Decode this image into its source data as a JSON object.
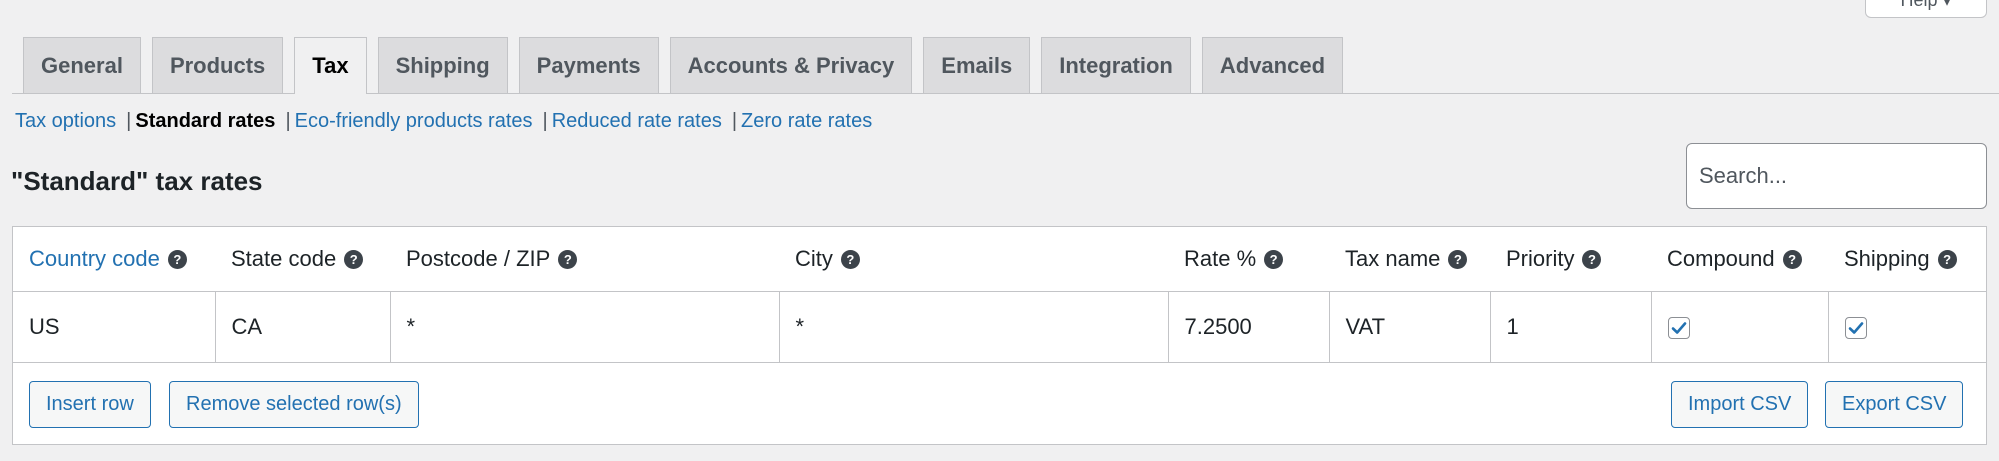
{
  "help": {
    "label": "Help ▾"
  },
  "tabs": [
    {
      "label": "General"
    },
    {
      "label": "Products"
    },
    {
      "label": "Tax",
      "active": true
    },
    {
      "label": "Shipping"
    },
    {
      "label": "Payments"
    },
    {
      "label": "Accounts & Privacy"
    },
    {
      "label": "Emails"
    },
    {
      "label": "Integration"
    },
    {
      "label": "Advanced"
    }
  ],
  "subnav": {
    "tax_options": "Tax options",
    "standard_rates": "Standard rates",
    "eco_friendly": "Eco-friendly products rates",
    "reduced": "Reduced rate rates",
    "zero": "Zero rate rates",
    "separator": "|"
  },
  "heading": "\"Standard\" tax rates",
  "search": {
    "placeholder": "Search..."
  },
  "table": {
    "columns": [
      {
        "label": "Country code"
      },
      {
        "label": "State code"
      },
      {
        "label": "Postcode / ZIP"
      },
      {
        "label": "City"
      },
      {
        "label": "Rate %"
      },
      {
        "label": "Tax name"
      },
      {
        "label": "Priority"
      },
      {
        "label": "Compound"
      },
      {
        "label": "Shipping"
      }
    ],
    "rows": [
      {
        "country": "US",
        "state": "CA",
        "postcode": "*",
        "city": "*",
        "rate": "7.2500",
        "tax_name": "VAT",
        "priority": "1",
        "compound": true,
        "shipping": true
      }
    ],
    "help_glyph": "?"
  },
  "buttons": {
    "insert_row": "Insert row",
    "remove_selected": "Remove selected row(s)",
    "import_csv": "Import CSV",
    "export_csv": "Export CSV"
  },
  "colors": {
    "link": "#2271b1",
    "background": "#f0f0f1",
    "tab_inactive": "#dcdcde"
  }
}
